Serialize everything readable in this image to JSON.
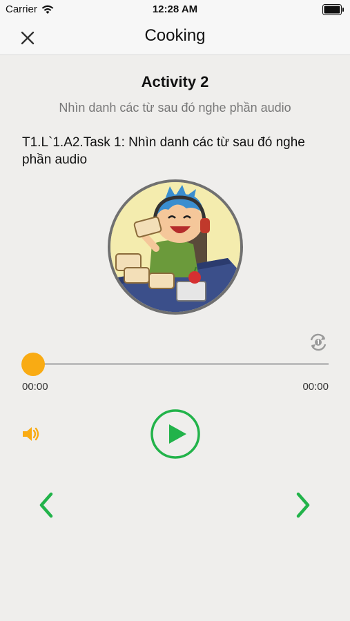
{
  "status_bar": {
    "carrier": "Carrier",
    "time": "12:28 AM"
  },
  "nav": {
    "title": "Cooking"
  },
  "activity": {
    "title": "Activity 2",
    "subtitle": "Nhìn danh các từ sau đó nghe phần audio",
    "task": "T1.L`1.A2.Task 1: Nhìn danh các từ sau đó nghe phần audio"
  },
  "player": {
    "current_time": "00:00",
    "total_time": "00:00",
    "progress": 0
  },
  "colors": {
    "accent": "#f9ab13",
    "play_green": "#22b34a",
    "nav_green": "#22b34a"
  },
  "icons": [
    "wifi-icon",
    "battery-icon",
    "close-icon",
    "repeat-icon",
    "volume-icon",
    "play-icon",
    "chevron-left-icon",
    "chevron-right-icon"
  ]
}
